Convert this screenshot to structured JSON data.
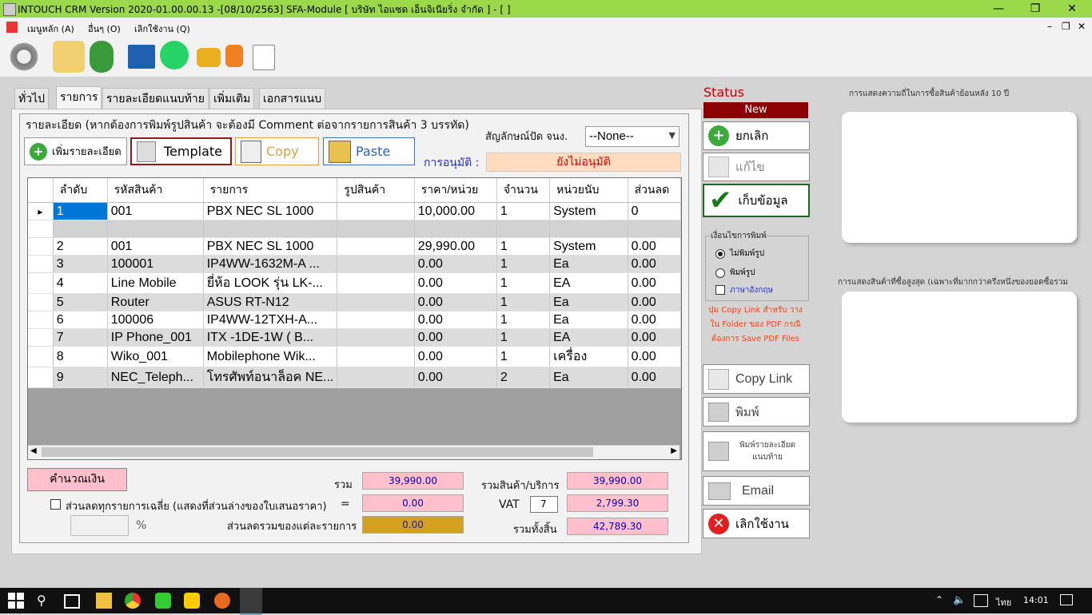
{
  "window": {
    "title": "INTOUCH CRM Version 2020-01.00.00.13 -[08/10/2563] SFA-Module  [ บริษัท ไอแซด เอ็นจิเนียริ่ง จำกัด ] - [ ]"
  },
  "menu": {
    "items": [
      "เมนูหลัก (A)",
      "อื่นๆ (O)",
      "เลิกใช้งาน (Q)"
    ]
  },
  "tabs": [
    "ทั่วไป",
    "รายการ",
    "รายละเอียดแนบท้าย",
    "เพิ่มเติม",
    "เอกสารแนบ"
  ],
  "group": {
    "title": "รายละเอียด (หากต้องการพิมพ์รูปสินค้า จะต้องมี Comment ต่อจากรายการสินค้า 3 บรรทัด)"
  },
  "buttons": {
    "add": "เพิ่มรายละเอียด",
    "template": "Template",
    "copy": "Copy",
    "paste": "Paste"
  },
  "rounding": {
    "label": "สัญลักษณ์ปัด จนง.",
    "value": "--None--"
  },
  "approval": {
    "label": "การอนุมัติ :",
    "value": "ยังไม่อนุมัติ"
  },
  "table": {
    "headers": [
      "ลำดับ",
      "รหัสสินค้า",
      "รายการ",
      "รูปสินค้า",
      "ราคา/หน่วย",
      "จำนวน",
      "หน่วยนับ",
      "ส่วนลด"
    ],
    "rows": [
      {
        "no": "1",
        "code": "001",
        "item": "PBX NEC SL 1000",
        "img": "",
        "price": "10,000.00",
        "qty": "1",
        "unit": "System",
        "disc": "0"
      },
      {
        "no": "",
        "code": "",
        "item": "",
        "img": "",
        "price": "",
        "qty": "",
        "unit": "",
        "disc": ""
      },
      {
        "no": "2",
        "code": "001",
        "item": "PBX NEC SL 1000",
        "img": "",
        "price": "29,990.00",
        "qty": "1",
        "unit": "System",
        "disc": "0.00"
      },
      {
        "no": "3",
        "code": "100001",
        "item": "IP4WW-1632M-A ...",
        "img": "",
        "price": "0.00",
        "qty": "1",
        "unit": "Ea",
        "disc": "0.00"
      },
      {
        "no": "4",
        "code": "Line Mobile",
        "item": "ยี่ห้อ LOOK รุ่น LK-...",
        "img": "",
        "price": "0.00",
        "qty": "1",
        "unit": "EA",
        "disc": "0.00"
      },
      {
        "no": "5",
        "code": "Router",
        "item": "ASUS RT-N12",
        "img": "",
        "price": "0.00",
        "qty": "1",
        "unit": "Ea",
        "disc": "0.00"
      },
      {
        "no": "6",
        "code": "100006",
        "item": "IP4WW-12TXH-A...",
        "img": "",
        "price": "0.00",
        "qty": "1",
        "unit": "Ea",
        "disc": "0.00"
      },
      {
        "no": "7",
        "code": "IP Phone_001",
        "item": "ITX -1DE-1W ( B...",
        "img": "",
        "price": "0.00",
        "qty": "1",
        "unit": "EA",
        "disc": "0.00"
      },
      {
        "no": "8",
        "code": "Wiko_001",
        "item": "Mobilephone Wik...",
        "img": "",
        "price": "0.00",
        "qty": "1",
        "unit": "เครื่อง",
        "disc": "0.00"
      },
      {
        "no": "9",
        "code": "NEC_Teleph...",
        "item": "โทรศัพท์อนาล็อค NE...",
        "img": "",
        "price": "0.00",
        "qty": "2",
        "unit": "Ea",
        "disc": "0.00"
      }
    ]
  },
  "totals": {
    "calc_button": "คำนวณเงิน",
    "sum_label": "รวม",
    "sum_value": "39,990.00",
    "avg_disc_label": "ส่วนลดทุกรายการเฉลี่ย (แสดงที่ส่วนล่างของใบเสนอราคา)",
    "eq": "=",
    "avg_disc_value": "0.00",
    "percent": "%",
    "item_disc_label": "ส่วนลดรวมของแต่ละรายการ",
    "item_disc_value": "0.00",
    "goods_label": "รวมสินค้า/บริการ",
    "goods_value": "39,990.00",
    "vat_label": "VAT",
    "vat_rate": "7",
    "vat_value": "2,799.30",
    "grand_label": "รวมทั้งสิ้น",
    "grand_value": "42,789.30"
  },
  "status": {
    "label": "Status",
    "value": "New"
  },
  "side": {
    "cancel": "ยกเลิก",
    "edit": "แก้ไข",
    "save": "เก็บข้อมูล",
    "print_group": "เงื่อนไขการพิมพ์",
    "opt_noimg": "ไม่พิมพ์รูป",
    "opt_img": "พิมพ์รูป",
    "opt_eng": "ภาษาอังกฤษ",
    "note": "ปุ่ม Copy Link สำหรับ วางใน Folder ของ PDF กรณีต้องการ Save PDF Files",
    "copylink": "Copy Link",
    "print": "พิมพ์",
    "print_detail": "พิมพ์รายละเอียด แนบท้าย",
    "email": "Email",
    "quit": "เลิกใช้งาน"
  },
  "charts": {
    "top_title": "การแสดงความถี่ในการซื้อสินค้าย้อนหลัง 10 ปี",
    "bottom_title": "การแสดงสินค้าที่ซื้อสูงสุด (เฉพาะที่มากกว่าครึ่งหนึ่งของยอดซื้อรวม"
  },
  "taskbar": {
    "lang": "ไทย",
    "time": "14:01"
  },
  "colors": {
    "titlebar": "#9bd94a",
    "status_new": "#8b0000",
    "pink": "#ffc0cb",
    "approval_bg": "#ffdcc0",
    "approval_text": "#e00000",
    "status_text": "#c00000"
  }
}
